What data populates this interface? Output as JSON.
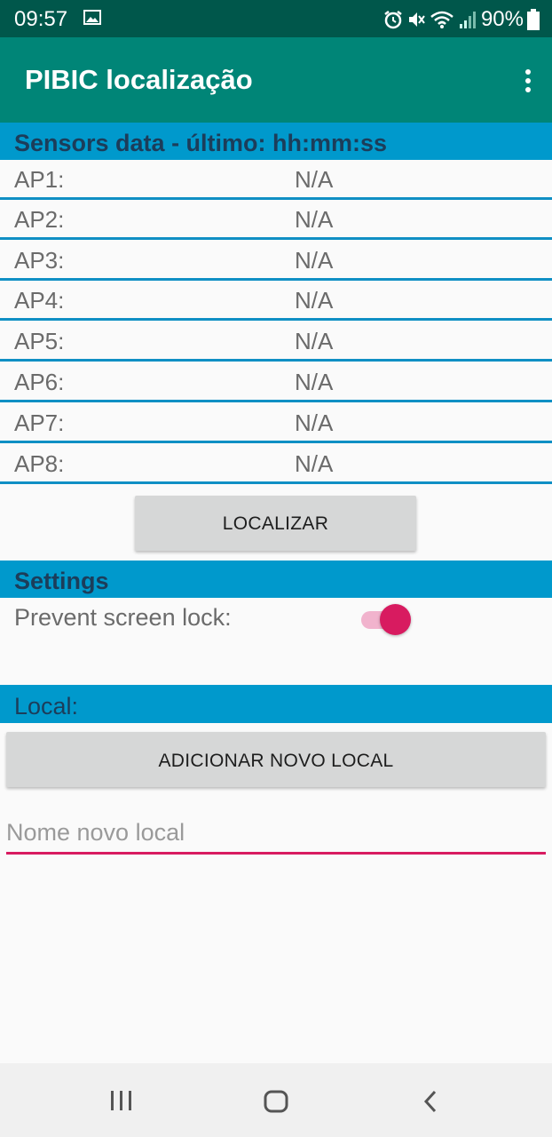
{
  "status_bar": {
    "time": "09:57",
    "battery": "90%",
    "icons": [
      "image-icon",
      "alarm-icon",
      "mute-icon",
      "wifi-icon",
      "signal-icon",
      "battery-icon"
    ]
  },
  "app_bar": {
    "title": "PIBIC localização",
    "menu_icon": "more-vert-icon",
    "color": "#008577"
  },
  "sensors": {
    "header": "Sensors data - último: hh:mm:ss",
    "rows": [
      {
        "label": "AP1:",
        "value": "N/A"
      },
      {
        "label": "AP2:",
        "value": "N/A"
      },
      {
        "label": "AP3:",
        "value": "N/A"
      },
      {
        "label": "AP4:",
        "value": "N/A"
      },
      {
        "label": "AP5:",
        "value": "N/A"
      },
      {
        "label": "AP6:",
        "value": "N/A"
      },
      {
        "label": "AP7:",
        "value": "N/A"
      },
      {
        "label": "AP8:",
        "value": "N/A"
      }
    ],
    "localize_button": "LOCALIZAR"
  },
  "settings": {
    "header": "Settings",
    "prevent_lock_label": "Prevent screen lock:",
    "prevent_lock_on": true
  },
  "local": {
    "header": "Local:",
    "add_button": "ADICIONAR NOVO LOCAL",
    "input_placeholder": "Nome novo local",
    "input_value": ""
  },
  "nav_bar": {
    "icons": [
      "recent-apps-icon",
      "home-icon",
      "back-icon"
    ]
  },
  "colors": {
    "section": "#0099cc",
    "accent": "#d81b60"
  }
}
